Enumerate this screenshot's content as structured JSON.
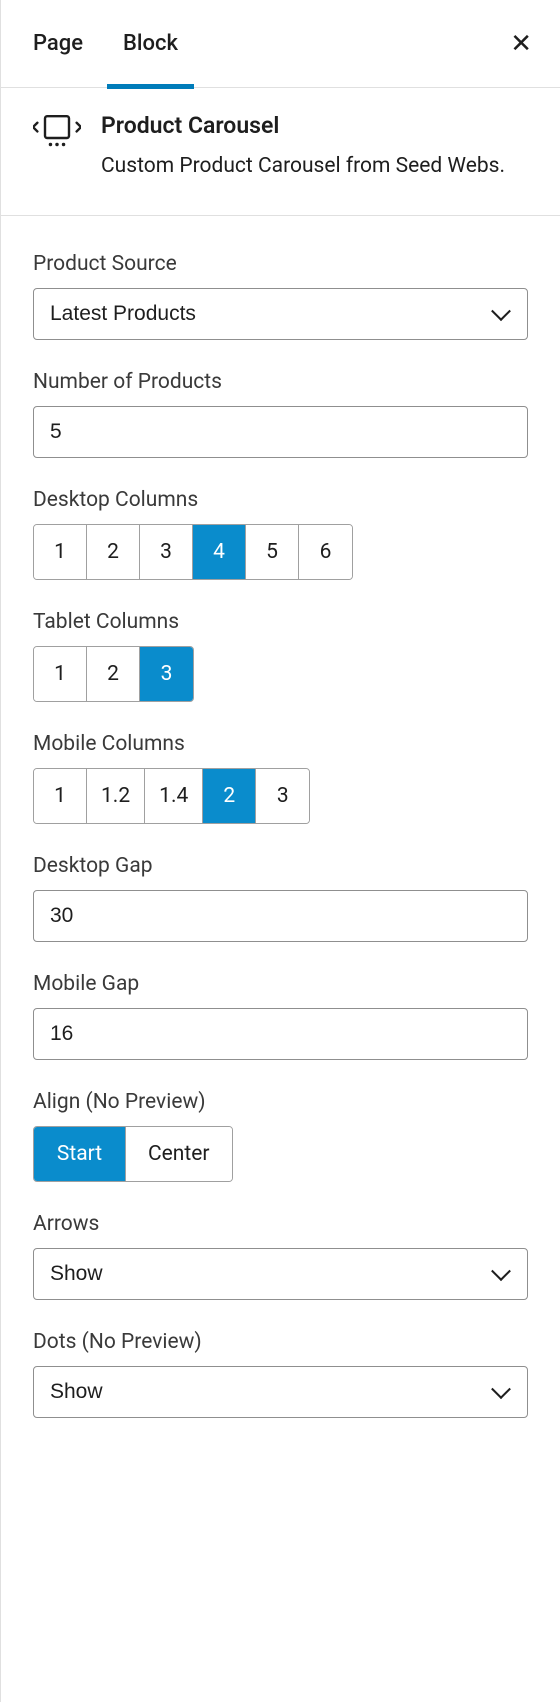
{
  "tabs": {
    "page": "Page",
    "block": "Block",
    "active": "block"
  },
  "block": {
    "title": "Product Carousel",
    "description": "Custom Product Carousel from Seed Webs."
  },
  "fields": {
    "product_source": {
      "label": "Product Source",
      "value": "Latest Products"
    },
    "num_products": {
      "label": "Number of Products",
      "value": "5"
    },
    "desktop_cols": {
      "label": "Desktop Columns",
      "options": [
        "1",
        "2",
        "3",
        "4",
        "5",
        "6"
      ],
      "active": "4"
    },
    "tablet_cols": {
      "label": "Tablet Columns",
      "options": [
        "1",
        "2",
        "3"
      ],
      "active": "3"
    },
    "mobile_cols": {
      "label": "Mobile Columns",
      "options": [
        "1",
        "1.2",
        "1.4",
        "2",
        "3"
      ],
      "active": "2"
    },
    "desktop_gap": {
      "label": "Desktop Gap",
      "value": "30"
    },
    "mobile_gap": {
      "label": "Mobile Gap",
      "value": "16"
    },
    "align": {
      "label": "Align (No Preview)",
      "options": [
        "Start",
        "Center"
      ],
      "active": "Start"
    },
    "arrows": {
      "label": "Arrows",
      "value": "Show"
    },
    "dots": {
      "label": "Dots (No Preview)",
      "value": "Show"
    }
  }
}
